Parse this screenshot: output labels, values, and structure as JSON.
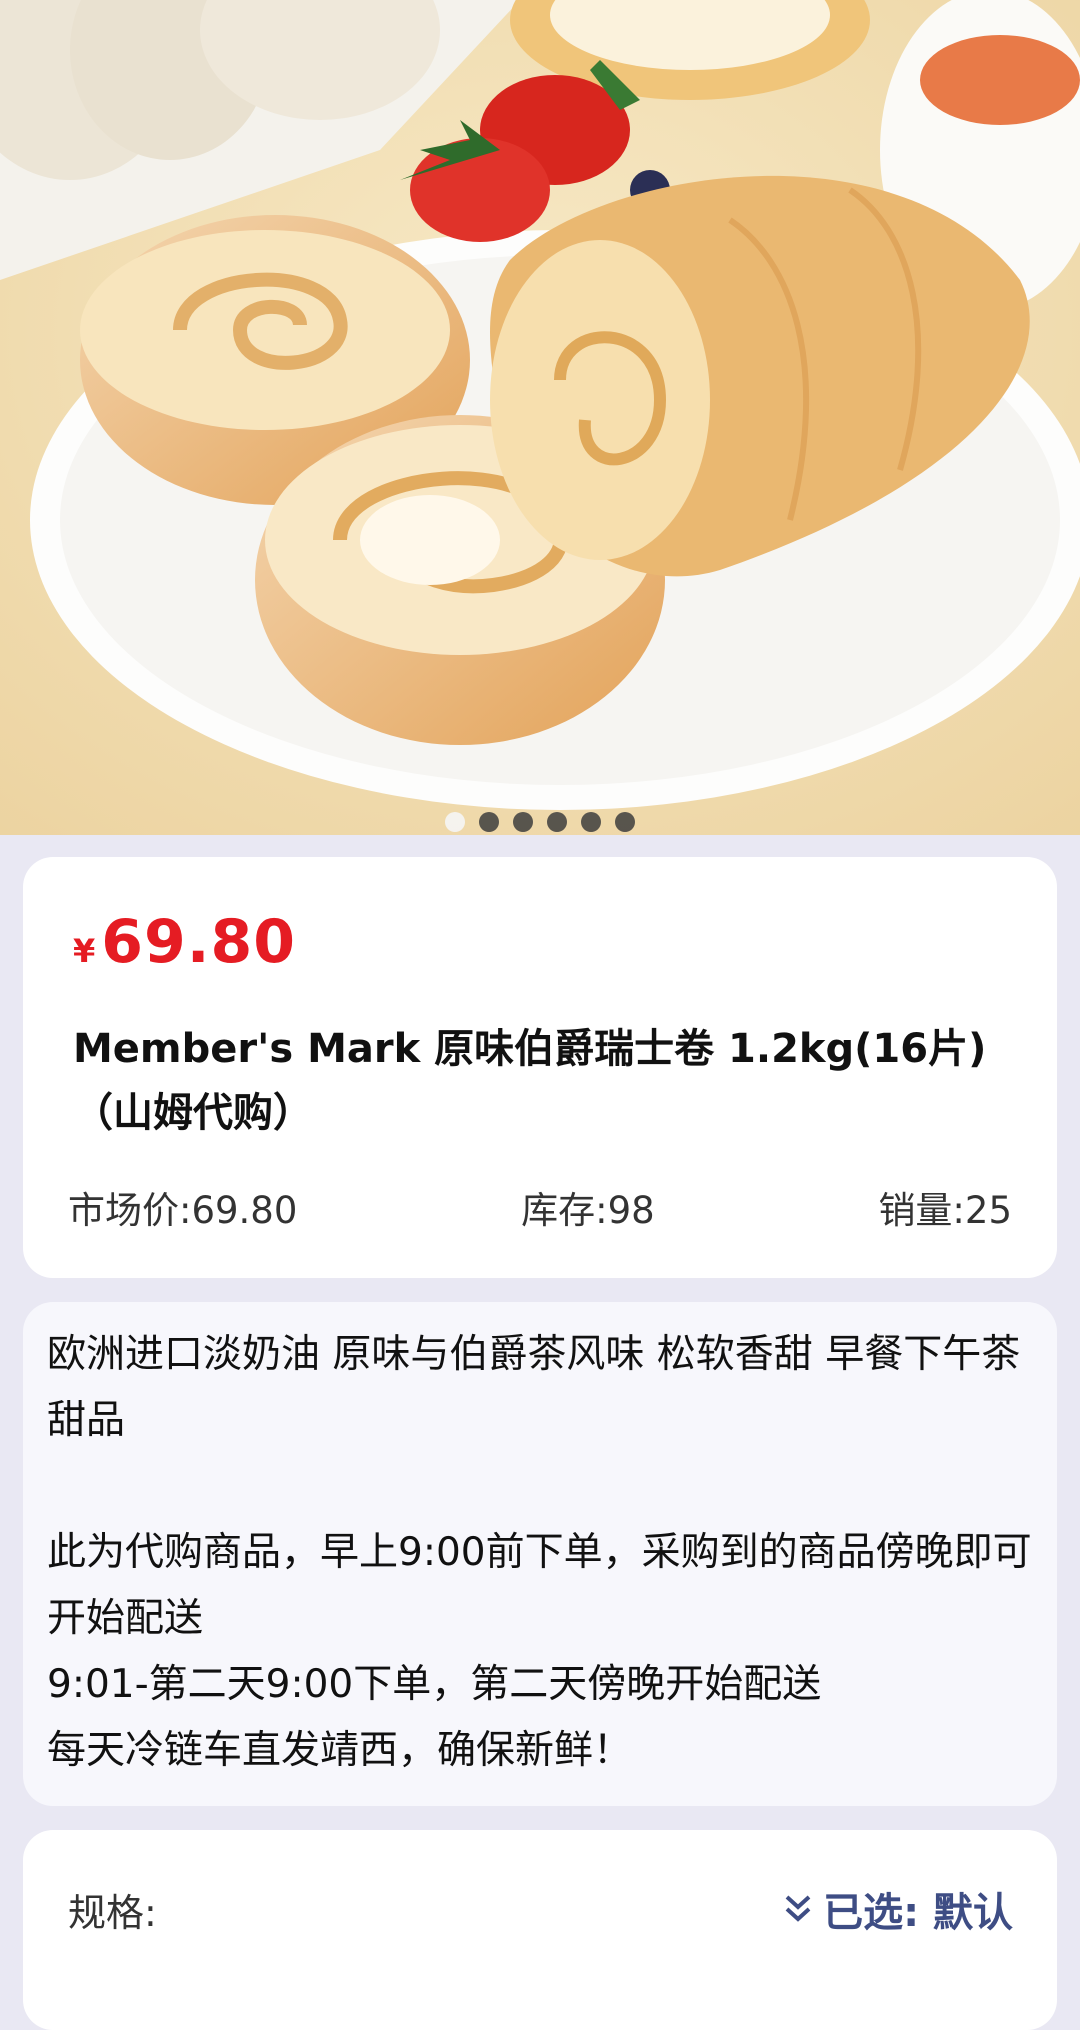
{
  "gallery": {
    "total_images": 6,
    "active_index": 0
  },
  "product": {
    "currency_symbol": "¥",
    "price": "69.80",
    "title": "Member's Mark 原味伯爵瑞士卷 1.2kg(16片)（山姆代购）",
    "market_price": "市场价:69.80",
    "stock": "库存:98",
    "sales": "销量:25"
  },
  "description": "欧洲进口淡奶油 原味与伯爵茶风味 松软香甜 早餐下午茶甜品\n\n此为代购商品，早上9:00前下单，采购到的商品傍晚即可开始配送\n9:01-第二天9:00下单，第二天傍晚开始配送\n每天冷链车直发靖西，确保新鲜！",
  "spec": {
    "label": "规格:",
    "selected": "已选: 默认"
  },
  "colors": {
    "price_red": "#e51c23",
    "spec_blue": "#3e4d84"
  }
}
